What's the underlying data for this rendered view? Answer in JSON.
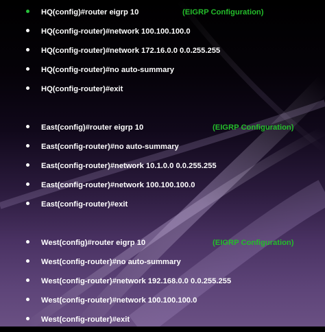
{
  "groups": [
    {
      "id": "hq",
      "lines": [
        {
          "text": "HQ(config)#router eigrp 10",
          "note": "(EIGRP Configuration)"
        },
        {
          "text": "HQ(config-router)#network 100.100.100.0"
        },
        {
          "text": "HQ(config-router)#network 172.16.0.0 0.0.255.255"
        },
        {
          "text": "HQ(config-router)#no auto-summary"
        },
        {
          "text": "HQ(config-router)#exit"
        }
      ]
    },
    {
      "id": "east",
      "lines": [
        {
          "text": "East(config)#router eigrp 10",
          "note": "(EIGRP Configuration)"
        },
        {
          "text": "East(config-router)#no auto-summary"
        },
        {
          "text": "East(config-router)#network 10.1.0.0 0.0.255.255"
        },
        {
          "text": "East(config-router)#network 100.100.100.0"
        },
        {
          "text": "East(config-router)#exit"
        }
      ]
    },
    {
      "id": "west",
      "lines": [
        {
          "text": "West(config)#router eigrp 10",
          "note": "(EIGRP Configuration)"
        },
        {
          "text": "West(config-router)#no auto-summary"
        },
        {
          "text": "West(config-router)#network 192.168.0.0 0.0.255.255"
        },
        {
          "text": "West(config-router)#network 100.100.100.0"
        },
        {
          "text": "West(config-router)#exit"
        }
      ]
    }
  ],
  "colors": {
    "text": "#ffffff",
    "note": "#24bd2b",
    "first_bullet": "#27c23a"
  }
}
